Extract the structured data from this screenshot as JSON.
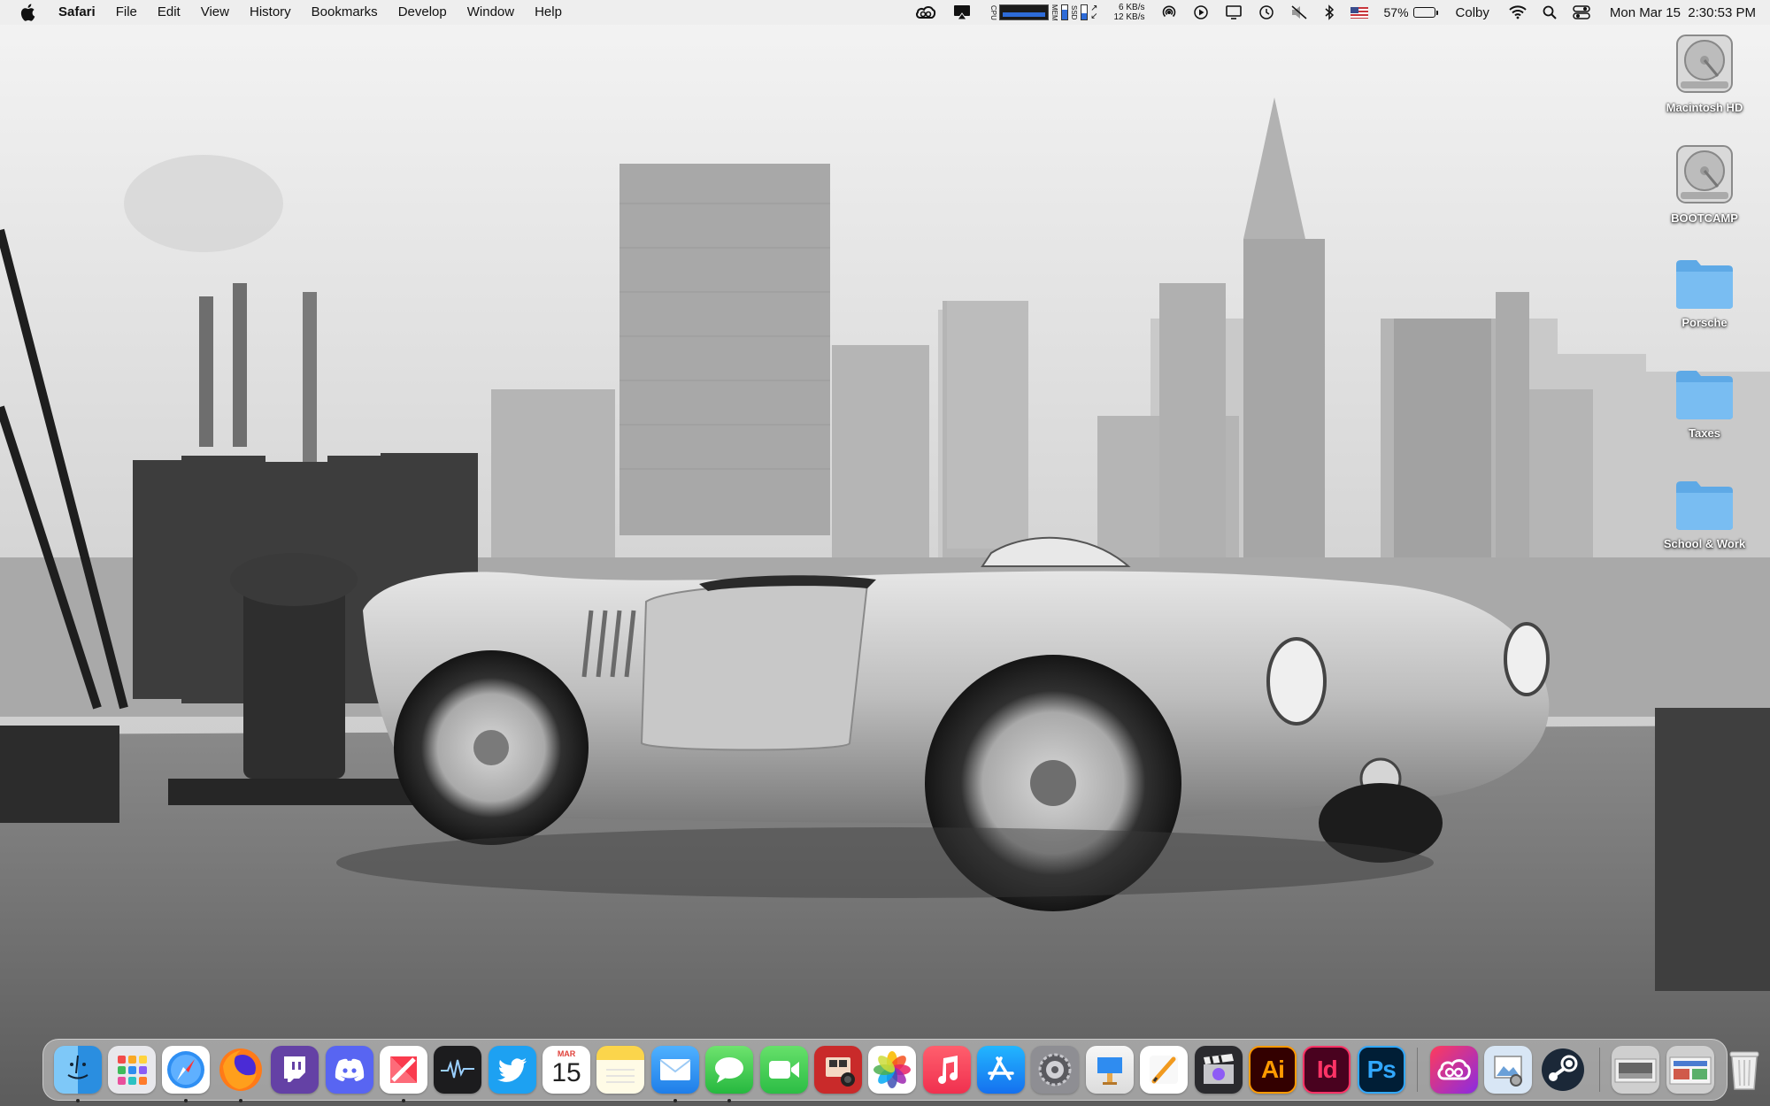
{
  "menubar": {
    "apple_icon": "apple-logo-icon",
    "app_name": "Safari",
    "menus": [
      "File",
      "Edit",
      "View",
      "History",
      "Bookmarks",
      "Develop",
      "Window",
      "Help"
    ],
    "network": {
      "up": "6 KB/s",
      "down": "12 KB/s"
    },
    "stat_labels": {
      "cpu": "CPU",
      "mem": "MEM",
      "ssd": "SSD"
    },
    "battery_percent": "57%",
    "battery_level": 0.57,
    "user_name": "Colby",
    "clock": "Mon Mar 15  2:30:53 PM",
    "status_icons": [
      "creative-cloud-icon",
      "airplay-menu-icon",
      "airdrop-icon",
      "play-icon",
      "display-icon",
      "time-machine-icon",
      "mute-icon",
      "bluetooth-icon",
      "us-flag-icon",
      "wifi-icon",
      "spotlight-search-icon",
      "control-center-icon"
    ]
  },
  "desktop_icons": [
    {
      "label": "Macintosh HD",
      "kind": "drive"
    },
    {
      "label": "BOOTCAMP",
      "kind": "drive"
    },
    {
      "label": "Porsche",
      "kind": "folder"
    },
    {
      "label": "Taxes",
      "kind": "folder"
    },
    {
      "label": "School & Work",
      "kind": "folder"
    }
  ],
  "dock": {
    "calendar_month": "MAR",
    "calendar_day": "15",
    "apps": [
      {
        "name": "finder",
        "running": true
      },
      {
        "name": "launchpad",
        "running": false
      },
      {
        "name": "safari",
        "running": true
      },
      {
        "name": "firefox",
        "running": true
      },
      {
        "name": "twitch",
        "running": false
      },
      {
        "name": "discord",
        "running": false
      },
      {
        "name": "news",
        "running": true
      },
      {
        "name": "activity-monitor",
        "running": false
      },
      {
        "name": "twitter",
        "running": false
      },
      {
        "name": "calendar",
        "running": false
      },
      {
        "name": "notes",
        "running": false
      },
      {
        "name": "mail",
        "running": true
      },
      {
        "name": "messages",
        "running": true
      },
      {
        "name": "facetime",
        "running": false
      },
      {
        "name": "photo-booth",
        "running": false
      },
      {
        "name": "photos",
        "running": false
      },
      {
        "name": "music",
        "running": false
      },
      {
        "name": "app-store",
        "running": false
      },
      {
        "name": "system-preferences",
        "running": false
      },
      {
        "name": "keynote",
        "running": false
      },
      {
        "name": "pages",
        "running": false
      },
      {
        "name": "final-cut-pro",
        "running": false
      },
      {
        "name": "illustrator",
        "label": "Ai",
        "running": false
      },
      {
        "name": "indesign",
        "label": "Id",
        "running": false
      },
      {
        "name": "photoshop",
        "label": "Ps",
        "running": false
      }
    ],
    "apps_group2": [
      "creative-cloud",
      "preview",
      "steam"
    ],
    "stacks": [
      "downloads-stack",
      "documents-stack",
      "trash"
    ]
  }
}
